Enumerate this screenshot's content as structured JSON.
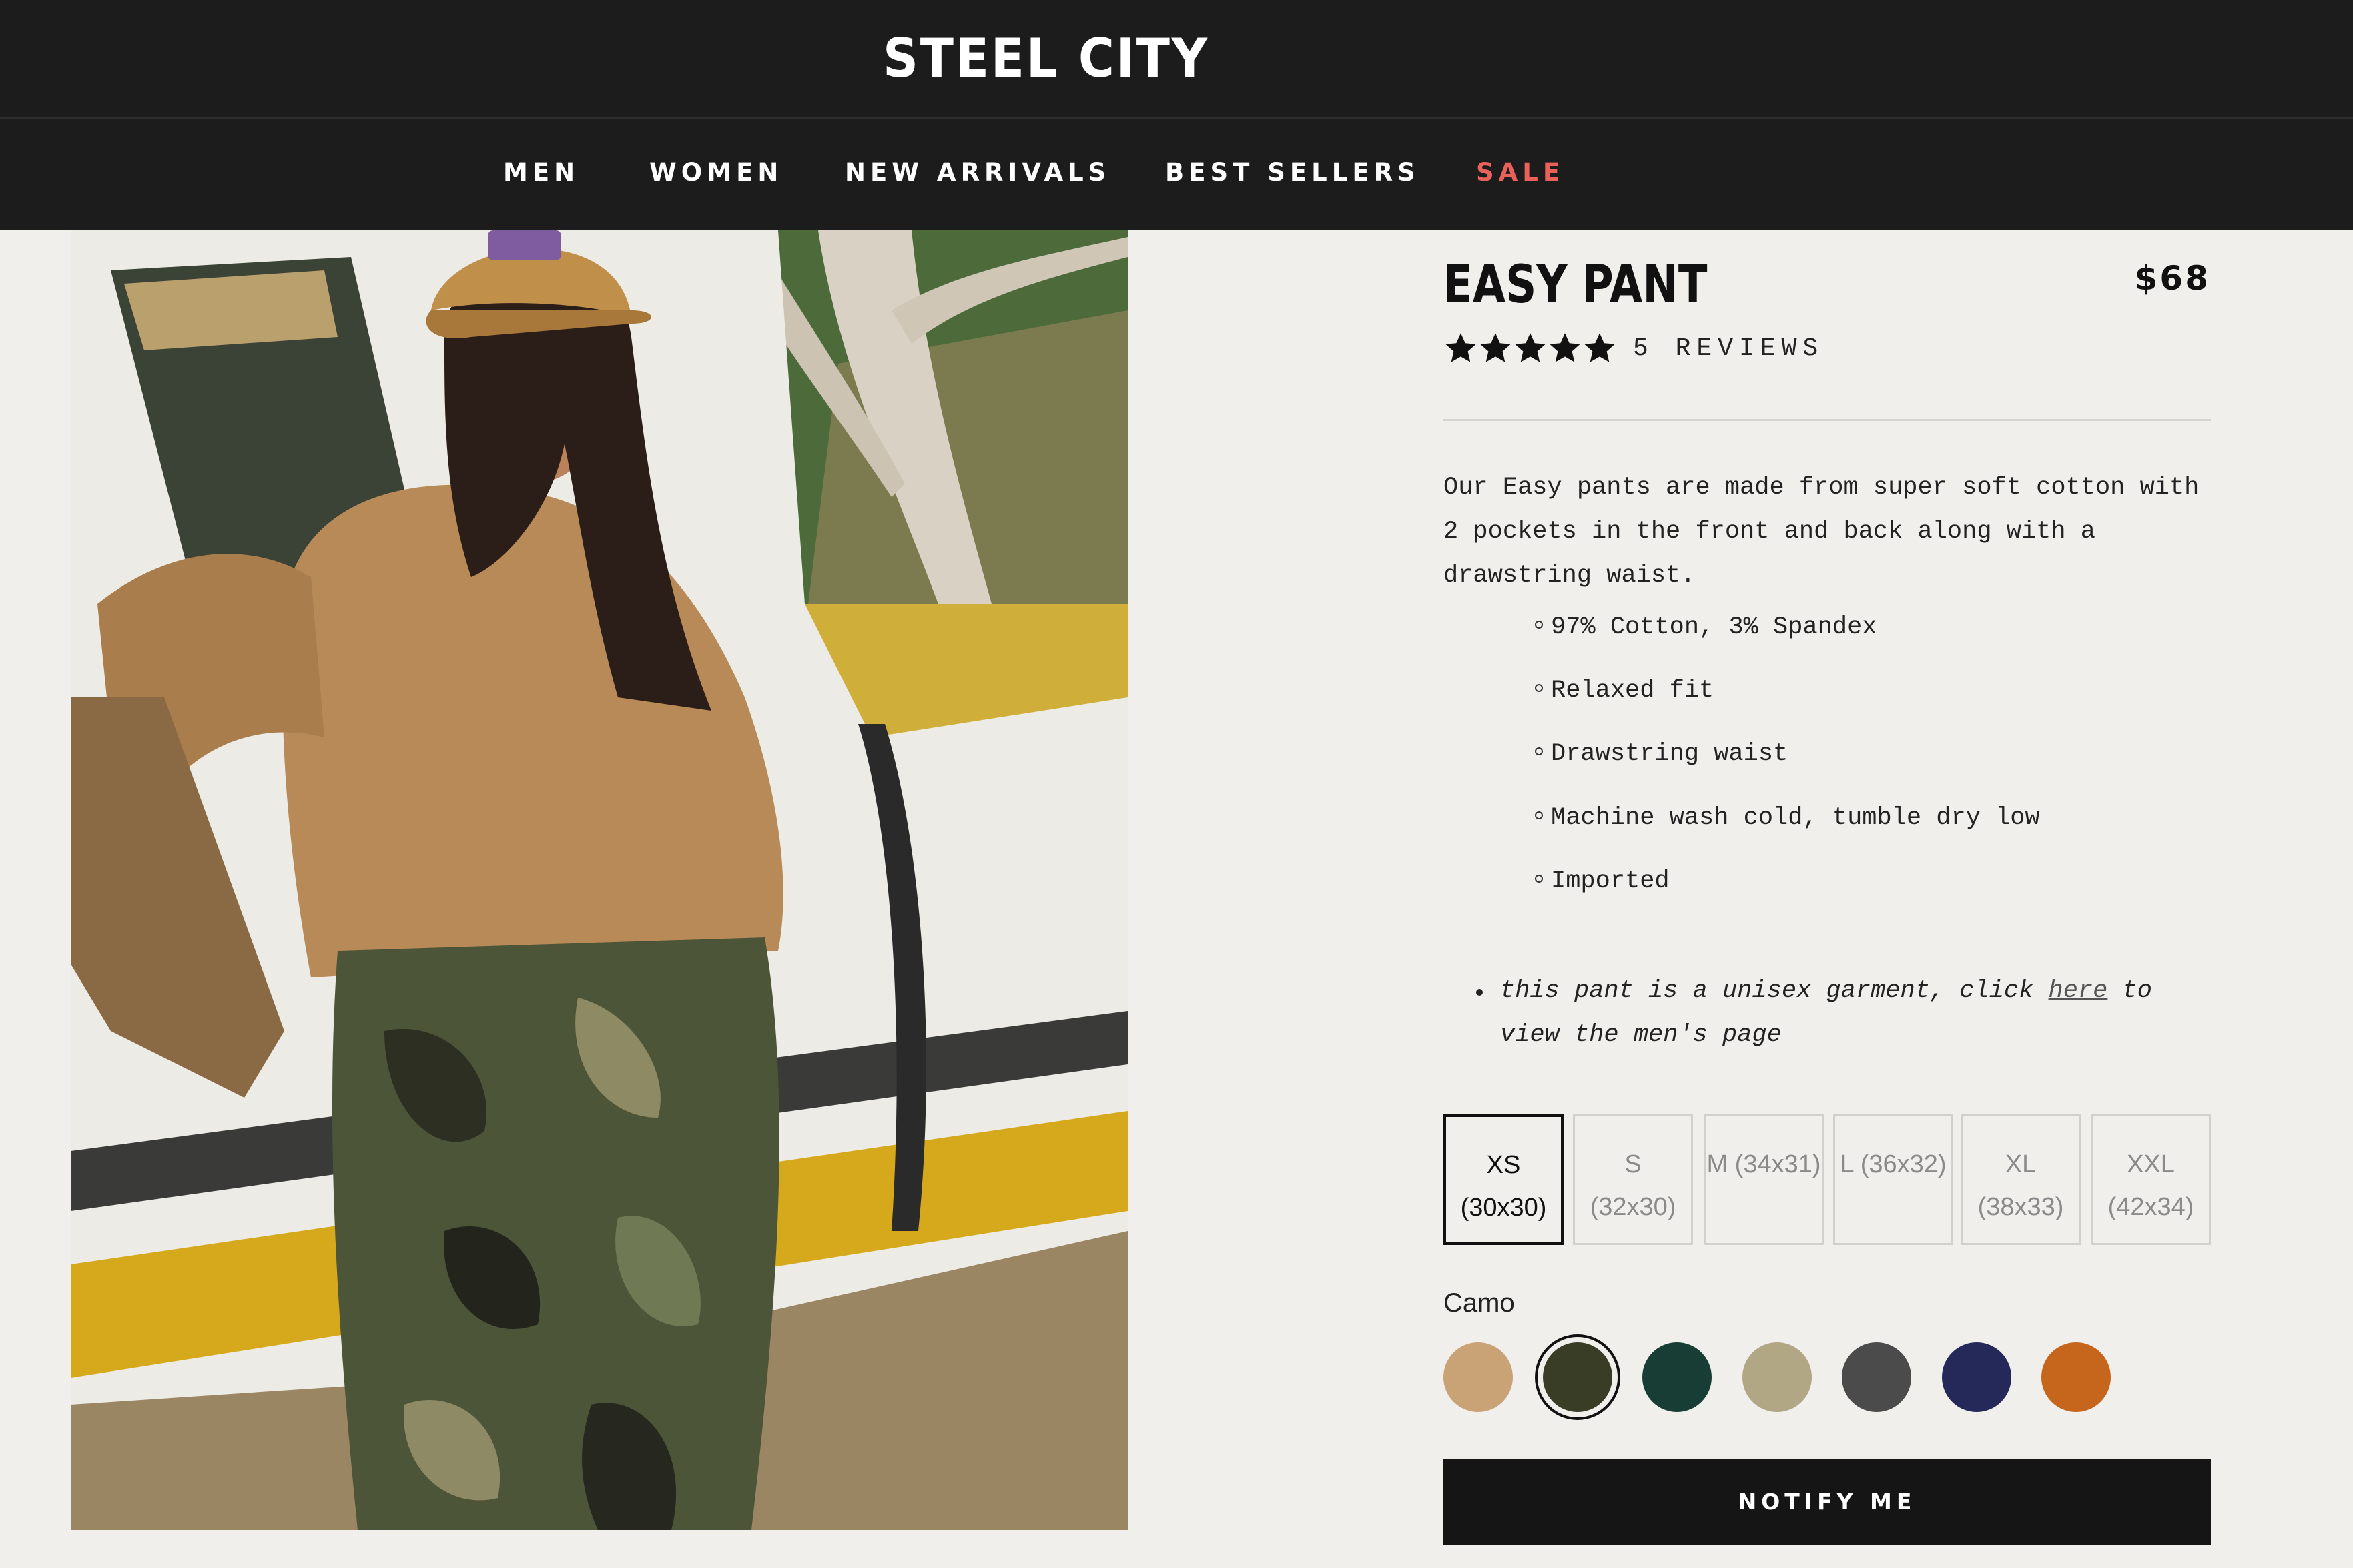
{
  "header": {
    "logo": "STEEL CITY",
    "nav": [
      {
        "label": "MEN"
      },
      {
        "label": "WOMEN"
      },
      {
        "label": "NEW ARRIVALS"
      },
      {
        "label": "BEST SELLERS"
      },
      {
        "label": "SALE",
        "color": "#e8615a"
      }
    ]
  },
  "product": {
    "title": "EASY PANT",
    "price": "$68",
    "rating": 5,
    "reviews": "5 REVIEWS",
    "description": "Our Easy pants are made from super soft cotton with 2 pockets in the front and back along with a drawstring waist.",
    "features": [
      "97% Cotton, 3% Spandex",
      "Relaxed fit",
      "Drawstring waist",
      "Machine wash cold, tumble dry low",
      "Imported"
    ],
    "note_before": "this pant is a unisex garment, click ",
    "note_link": "here",
    "note_after": " to view the men's page",
    "sizes": [
      {
        "line1": "XS",
        "line2": "(30x30)",
        "selected": true
      },
      {
        "line1": "S",
        "line2": "(32x30)"
      },
      {
        "line1": "M (34x31)",
        "line2": ""
      },
      {
        "line1": "L (36x32)",
        "line2": ""
      },
      {
        "line1": "XL",
        "line2": "(38x33)"
      },
      {
        "line1": "XXL",
        "line2": "(42x34)"
      }
    ],
    "color_label": "Camo",
    "swatches": [
      {
        "color": "#c9a275"
      },
      {
        "color": "#3a3d26",
        "selected": true
      },
      {
        "color": "#183d34"
      },
      {
        "color": "#b1a784"
      },
      {
        "color": "#4b4b4b"
      },
      {
        "color": "#25295a"
      },
      {
        "color": "#c5661c"
      }
    ],
    "cta": "NOTIFY ME"
  },
  "colors": {
    "header_bg": "#1c1c1c",
    "page_bg": "#f0efec",
    "sale": "#e8615a",
    "button_bg": "#151515"
  }
}
